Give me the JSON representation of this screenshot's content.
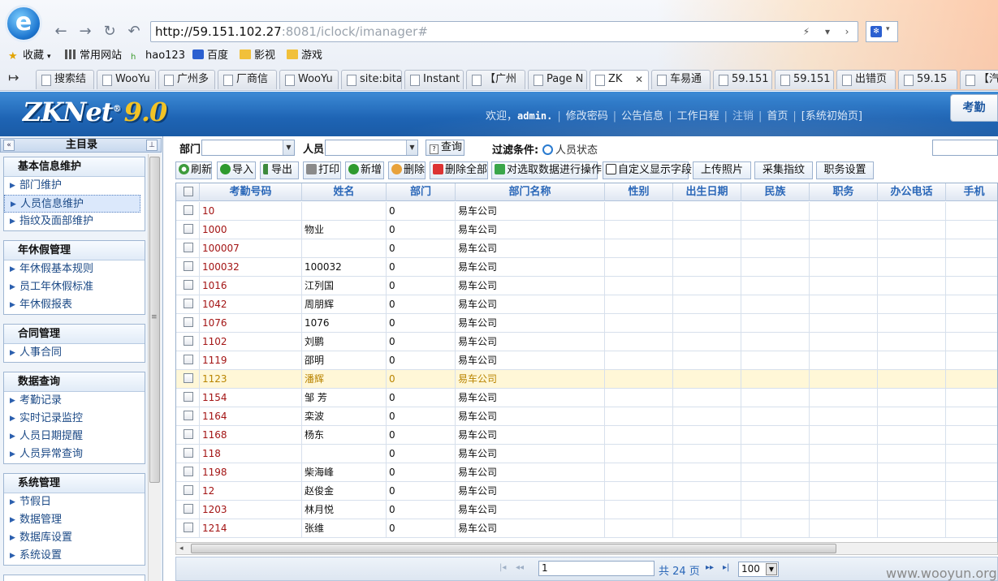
{
  "browser": {
    "url_host": "http://59.151.102.27",
    "url_rest": ":8081/iclock/imanager#",
    "bookmarks": [
      "收藏",
      "常用网站",
      "hao123",
      "百度",
      "影视",
      "游戏"
    ],
    "tabs": [
      "搜索结",
      "WooYu",
      "广州多",
      "厂商信",
      "WooYu",
      "site:bita",
      "Instant",
      "【广州",
      "Page N",
      "ZK",
      "车易通",
      "59.151",
      "59.151",
      "出错页",
      "59.15",
      "【汽"
    ],
    "active_tab": 9,
    "tab_close": "✕"
  },
  "header": {
    "logo": "ZKNet",
    "logo_reg": "®",
    "version": "9.0",
    "welcome": "欢迎，",
    "user": "admin.",
    "links": [
      "修改密码",
      "公告信息",
      "工作日程",
      "注销",
      "首页",
      "[系统初始页]"
    ],
    "attend_button": "考勤"
  },
  "sidebar": {
    "title": "主目录",
    "groups": [
      {
        "title": "基本信息维护",
        "items": [
          "部门维护",
          "人员信息维护",
          "指纹及面部维护"
        ],
        "selected": 1
      },
      {
        "title": "年休假管理",
        "items": [
          "年休假基本规则",
          "员工年休假标准",
          "年休假报表"
        ]
      },
      {
        "title": "合同管理",
        "items": [
          "人事合同"
        ]
      },
      {
        "title": "数据查询",
        "items": [
          "考勤记录",
          "实时记录监控",
          "人员日期提醒",
          "人员异常查询"
        ]
      },
      {
        "title": "系统管理",
        "items": [
          "节假日",
          "数据管理",
          "数据库设置",
          "系统设置"
        ]
      }
    ]
  },
  "filter": {
    "dept_label": "部门",
    "person_label": "人员",
    "query_button": "查询",
    "filter_label": "过滤条件:",
    "status_label": "人员状态"
  },
  "toolbar": [
    "刷新",
    "导入",
    "导出",
    "打印",
    "新增",
    "删除",
    "删除全部",
    "对选取数据进行操作",
    "自定义显示字段",
    "上传照片",
    "采集指纹",
    "职务设置"
  ],
  "grid": {
    "columns": [
      "考勤号码",
      "姓名",
      "部门",
      "部门名称",
      "性别",
      "出生日期",
      "民族",
      "职务",
      "办公电话",
      "手机"
    ],
    "rows": [
      [
        "10",
        "",
        "0",
        "易车公司"
      ],
      [
        "1000",
        "物业",
        "0",
        "易车公司"
      ],
      [
        "100007",
        "",
        "0",
        "易车公司"
      ],
      [
        "100032",
        "100032",
        "0",
        "易车公司"
      ],
      [
        "1016",
        "江列国",
        "0",
        "易车公司"
      ],
      [
        "1042",
        "周朋辉",
        "0",
        "易车公司"
      ],
      [
        "1076",
        "1076",
        "0",
        "易车公司"
      ],
      [
        "1102",
        "刘鹏",
        "0",
        "易车公司"
      ],
      [
        "1119",
        "邵明",
        "0",
        "易车公司"
      ],
      [
        "1123",
        "潘辉",
        "0",
        "易车公司"
      ],
      [
        "1154",
        "邹 芳",
        "0",
        "易车公司"
      ],
      [
        "1164",
        "栾波",
        "0",
        "易车公司"
      ],
      [
        "1168",
        "杨东",
        "0",
        "易车公司"
      ],
      [
        "118",
        "",
        "0",
        "易车公司"
      ],
      [
        "1198",
        "柴海峰",
        "0",
        "易车公司"
      ],
      [
        "12",
        "赵俊金",
        "0",
        "易车公司"
      ],
      [
        "1203",
        "林月悦",
        "0",
        "易车公司"
      ],
      [
        "1214",
        "张维",
        "0",
        "易车公司"
      ]
    ],
    "highlight_row": 9
  },
  "pager": {
    "page": "1",
    "total_text": "共 24 页",
    "page_size": "100"
  },
  "watermark": "www.wooyun.org"
}
